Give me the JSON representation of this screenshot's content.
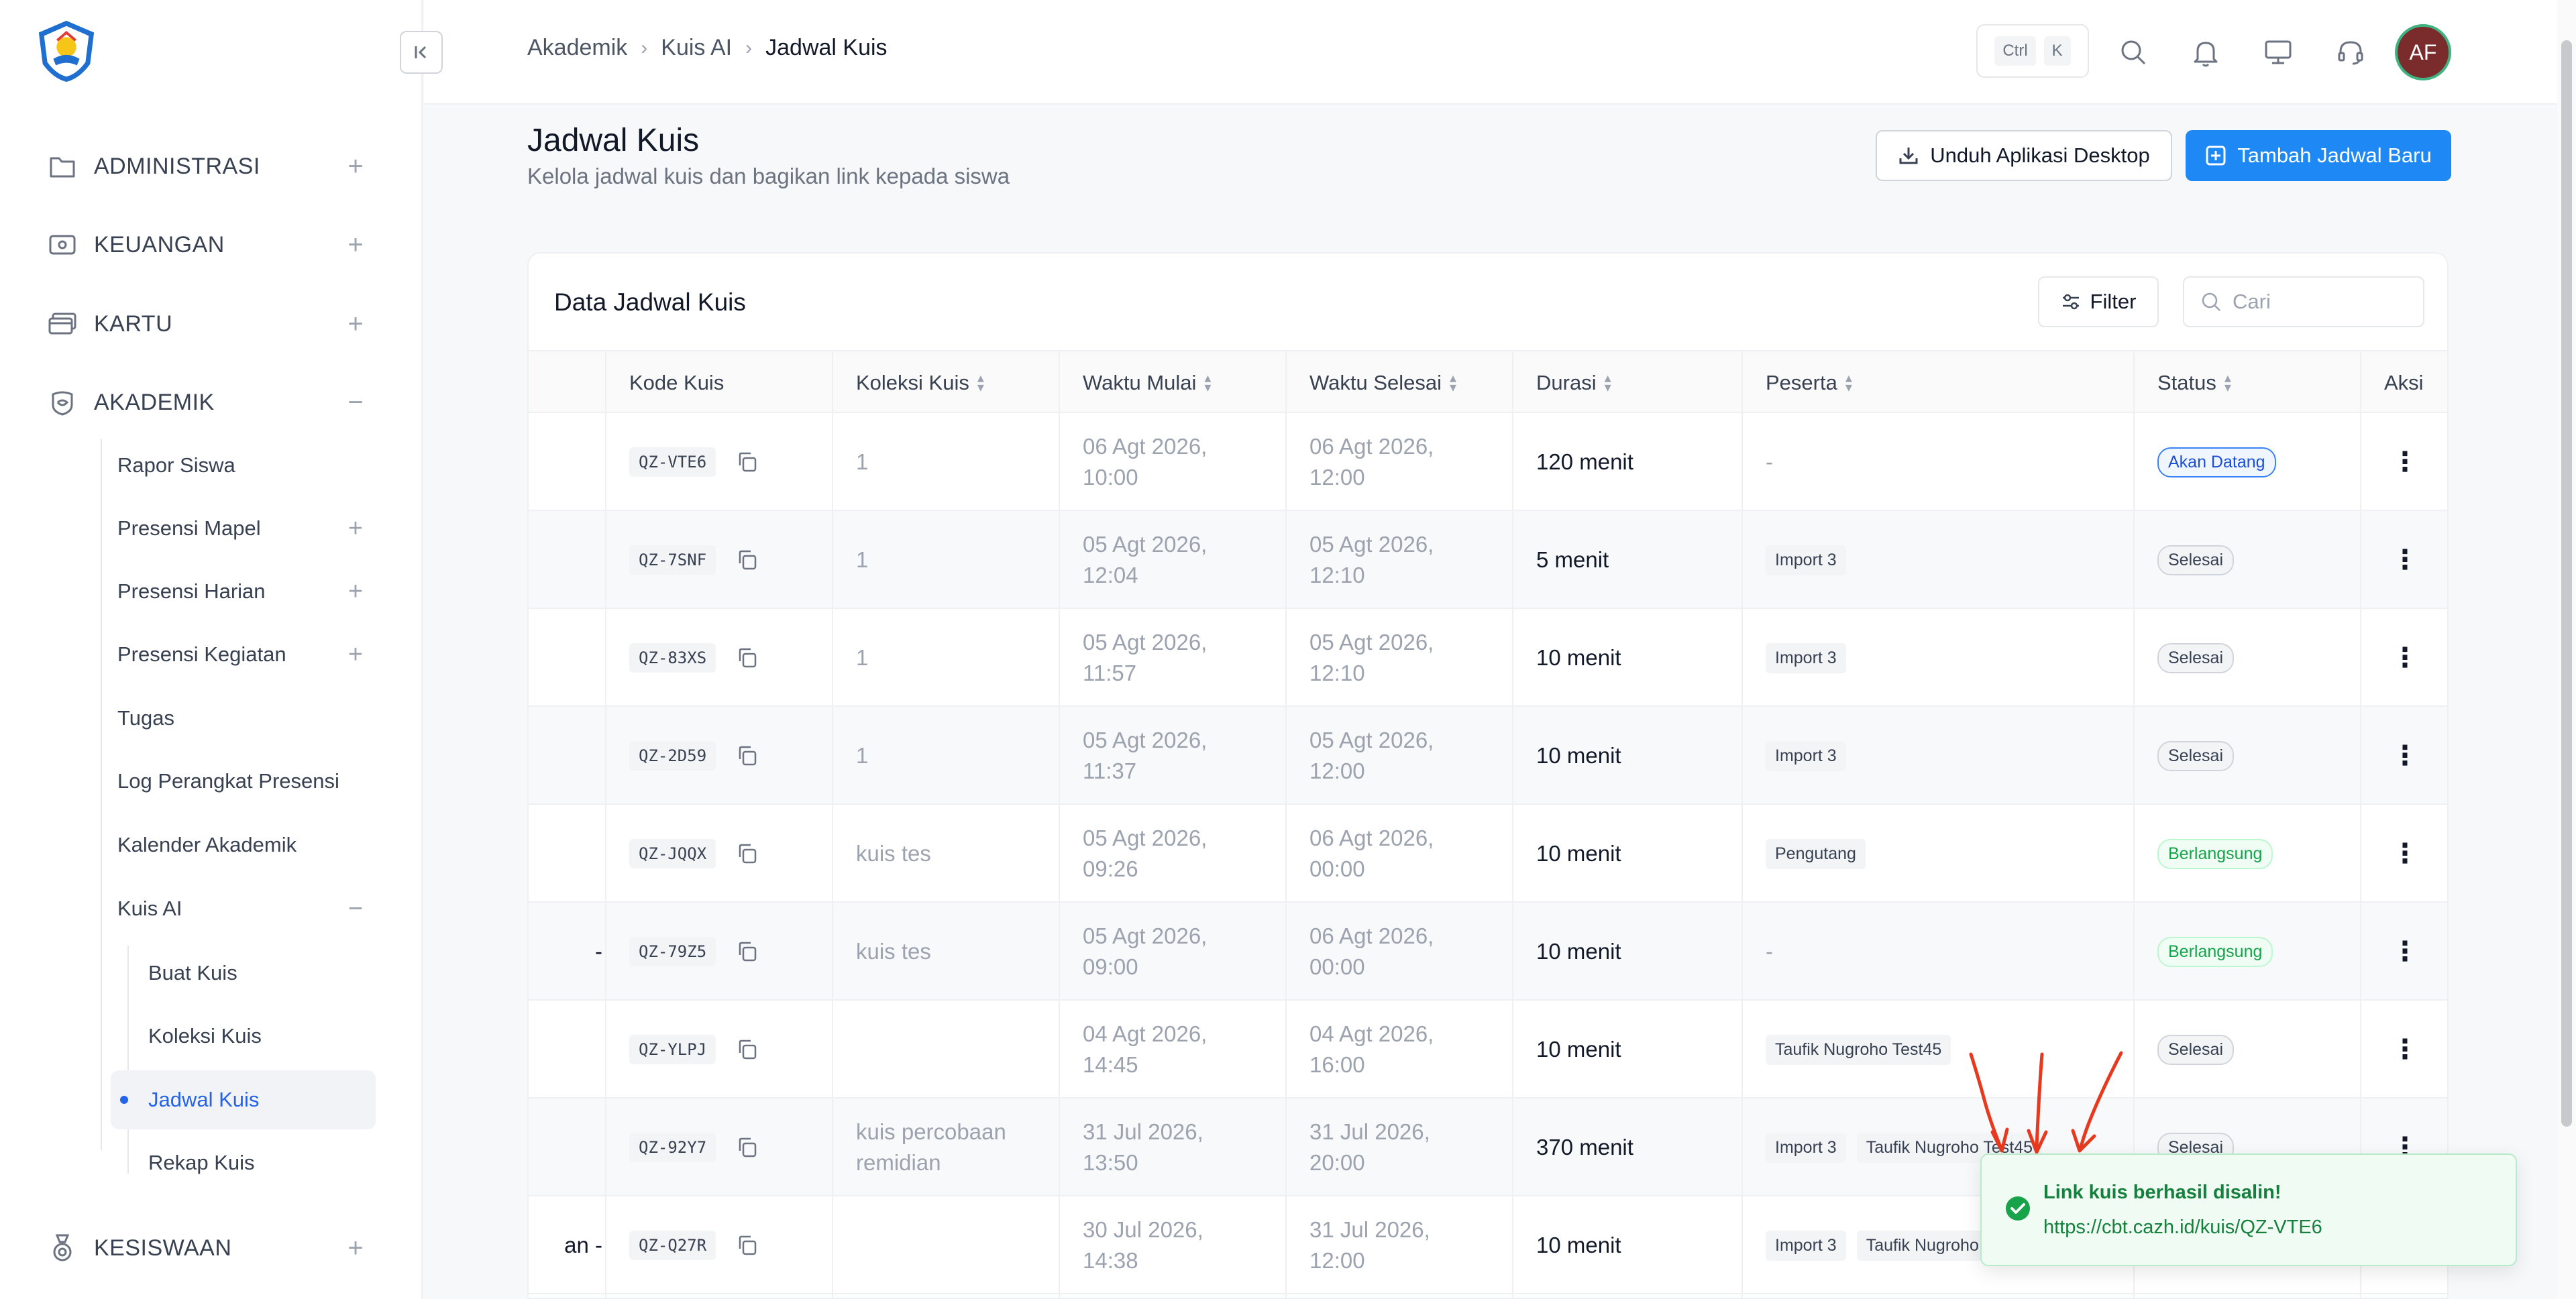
{
  "sidebar": {
    "groups": [
      {
        "label": "ADMINISTRASI",
        "toggle": "+"
      },
      {
        "label": "KEUANGAN",
        "toggle": "+"
      },
      {
        "label": "KARTU",
        "toggle": "+"
      },
      {
        "label": "AKADEMIK",
        "toggle": "−"
      },
      {
        "label": "KESISWAAN",
        "toggle": "+"
      }
    ],
    "akademik_items": [
      {
        "label": "Rapor Siswa",
        "toggle": ""
      },
      {
        "label": "Presensi Mapel",
        "toggle": "+"
      },
      {
        "label": "Presensi Harian",
        "toggle": "+"
      },
      {
        "label": "Presensi Kegiatan",
        "toggle": "+"
      },
      {
        "label": "Tugas",
        "toggle": ""
      },
      {
        "label": "Log Perangkat Presensi",
        "toggle": ""
      },
      {
        "label": "Kalender Akademik",
        "toggle": ""
      },
      {
        "label": "Kuis AI",
        "toggle": "−"
      }
    ],
    "kuis_items": [
      {
        "label": "Buat Kuis"
      },
      {
        "label": "Koleksi Kuis"
      },
      {
        "label": "Jadwal Kuis",
        "active": true
      },
      {
        "label": "Rekap Kuis"
      }
    ]
  },
  "topbar": {
    "breadcrumb": [
      "Akademik",
      "Kuis AI",
      "Jadwal Kuis"
    ],
    "shortcut": [
      "Ctrl",
      "K"
    ],
    "avatar_initials": "AF"
  },
  "header": {
    "title": "Jadwal Kuis",
    "subtitle": "Kelola jadwal kuis dan bagikan link kepada siswa",
    "download_button": "Unduh Aplikasi Desktop",
    "add_button": "Tambah Jadwal Baru"
  },
  "card": {
    "title": "Data Jadwal Kuis",
    "filter_label": "Filter",
    "search_placeholder": "Cari"
  },
  "table": {
    "columns": [
      "Kode Kuis",
      "Koleksi Kuis",
      "Waktu Mulai",
      "Waktu Selesai",
      "Durasi",
      "Peserta",
      "Status",
      "Aksi"
    ],
    "rows": [
      {
        "lead": "",
        "code": "QZ-VTE6",
        "collection": "1",
        "start": [
          "06 Agt 2026,",
          "10:00"
        ],
        "end": [
          "06 Agt 2026,",
          "12:00"
        ],
        "duration": "120 menit",
        "participants": [],
        "participants_text": "-",
        "status": "Akan Datang",
        "status_kind": "upcoming"
      },
      {
        "lead": "",
        "code": "QZ-7SNF",
        "collection": "1",
        "start": [
          "05 Agt 2026,",
          "12:04"
        ],
        "end": [
          "05 Agt 2026,",
          "12:10"
        ],
        "duration": "5 menit",
        "participants": [
          "Import 3"
        ],
        "participants_text": "",
        "status": "Selesai",
        "status_kind": "done"
      },
      {
        "lead": "",
        "code": "QZ-83XS",
        "collection": "1",
        "start": [
          "05 Agt 2026,",
          "11:57"
        ],
        "end": [
          "05 Agt 2026,",
          "12:10"
        ],
        "duration": "10 menit",
        "participants": [
          "Import 3"
        ],
        "participants_text": "",
        "status": "Selesai",
        "status_kind": "done"
      },
      {
        "lead": "",
        "code": "QZ-2D59",
        "collection": "1",
        "start": [
          "05 Agt 2026,",
          "11:37"
        ],
        "end": [
          "05 Agt 2026,",
          "12:00"
        ],
        "duration": "10 menit",
        "participants": [
          "Import 3"
        ],
        "participants_text": "",
        "status": "Selesai",
        "status_kind": "done"
      },
      {
        "lead": "",
        "code": "QZ-JQQX",
        "collection": "kuis tes",
        "start": [
          "05 Agt 2026,",
          "09:26"
        ],
        "end": [
          "06 Agt 2026,",
          "00:00"
        ],
        "duration": "10 menit",
        "participants": [
          "Pengutang"
        ],
        "participants_text": "",
        "status": "Berlangsung",
        "status_kind": "live"
      },
      {
        "lead": "-",
        "code": "QZ-79Z5",
        "collection": "kuis tes",
        "start": [
          "05 Agt 2026,",
          "09:00"
        ],
        "end": [
          "06 Agt 2026,",
          "00:00"
        ],
        "duration": "10 menit",
        "participants": [],
        "participants_text": "-",
        "status": "Berlangsung",
        "status_kind": "live"
      },
      {
        "lead": "",
        "code": "QZ-YLPJ",
        "collection": "",
        "start": [
          "04 Agt 2026,",
          "14:45"
        ],
        "end": [
          "04 Agt 2026,",
          "16:00"
        ],
        "duration": "10 menit",
        "participants": [
          "Taufik Nugroho Test45"
        ],
        "participants_text": "",
        "status": "Selesai",
        "status_kind": "done"
      },
      {
        "lead": "",
        "code": "QZ-92Y7",
        "collection": "kuis percobaan remidian",
        "start": [
          "31 Jul 2026,",
          "13:50"
        ],
        "end": [
          "31 Jul 2026,",
          "20:00"
        ],
        "duration": "370 menit",
        "participants": [
          "Import 3",
          "Taufik Nugroho Test45"
        ],
        "participants_text": "",
        "status": "Selesai",
        "status_kind": "done"
      },
      {
        "lead": "an -",
        "code": "QZ-Q27R",
        "collection": "",
        "start": [
          "30 Jul 2026,",
          "14:38"
        ],
        "end": [
          "31 Jul 2026,",
          "12:00"
        ],
        "duration": "10 menit",
        "participants": [
          "Import 3",
          "Taufik Nugroho"
        ],
        "participants_text": "",
        "status": "",
        "status_kind": ""
      }
    ]
  },
  "toast": {
    "title": "Link kuis berhasil disalin!",
    "link": "https://cbt.cazh.id/kuis/QZ-VTE6"
  },
  "colors": {
    "primary": "#1e88f5",
    "active_link": "#2563eb",
    "success": "#16a34a",
    "annotation_red": "#e8391f"
  }
}
